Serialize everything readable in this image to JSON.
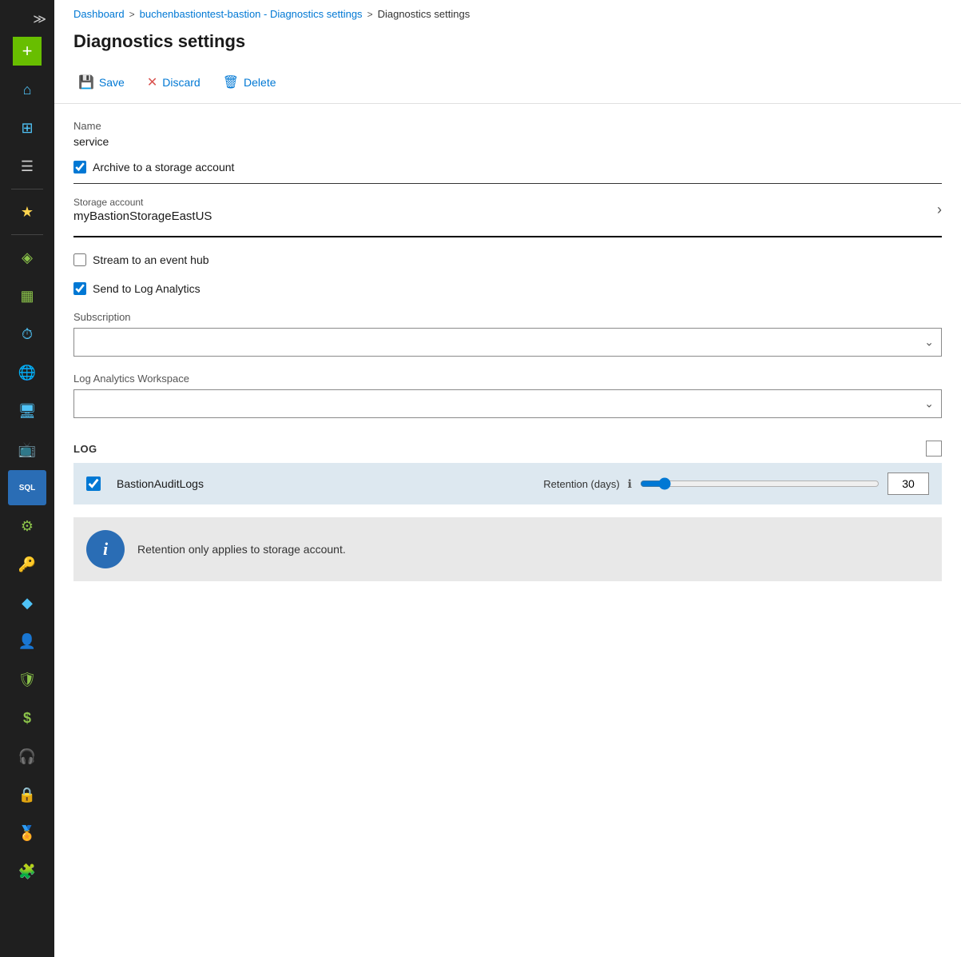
{
  "breadcrumb": {
    "items": [
      "Dashboard",
      "buchenbastiontest-bastion - Diagnostics settings",
      "Diagnostics settings"
    ],
    "separators": [
      ">",
      ">"
    ]
  },
  "page": {
    "title": "Diagnostics settings"
  },
  "toolbar": {
    "save_label": "Save",
    "discard_label": "Discard",
    "delete_label": "Delete"
  },
  "form": {
    "name_label": "Name",
    "name_value": "service",
    "archive_checkbox_label": "Archive to a storage account",
    "archive_checked": true,
    "storage_account_label": "Storage account",
    "storage_account_value": "myBastionStorageEastUS",
    "event_hub_checkbox_label": "Stream to an event hub",
    "event_hub_checked": false,
    "log_analytics_checkbox_label": "Send to Log Analytics",
    "log_analytics_checked": true,
    "subscription_label": "Subscription",
    "subscription_value": "",
    "log_analytics_workspace_label": "Log Analytics Workspace",
    "log_analytics_workspace_value": ""
  },
  "log_section": {
    "title": "LOG",
    "rows": [
      {
        "name": "BastionAuditLogs",
        "checked": true,
        "retention_label": "Retention (days)",
        "retention_value": 30,
        "slider_min": 0,
        "slider_max": 365,
        "slider_value": 30
      }
    ]
  },
  "info_box": {
    "text": "Retention only applies to storage account."
  },
  "sidebar": {
    "icons": [
      {
        "name": "collapse-icon",
        "symbol": "≫",
        "color": "#ccc"
      },
      {
        "name": "add-icon",
        "symbol": "+",
        "color": "#fff",
        "bg": "#68be00"
      },
      {
        "name": "home-icon",
        "symbol": "⌂",
        "color": "#4fc3f7"
      },
      {
        "name": "dashboard-icon",
        "symbol": "⊞",
        "color": "#4fc3f7"
      },
      {
        "name": "menu-icon",
        "symbol": "☰",
        "color": "#ccc"
      },
      {
        "name": "favorites-icon",
        "symbol": "★",
        "color": "#ffd54f"
      },
      {
        "name": "resource-icon",
        "symbol": "◈",
        "color": "#8bc34a"
      },
      {
        "name": "grid-icon",
        "symbol": "▦",
        "color": "#8bc34a"
      },
      {
        "name": "clock-icon",
        "symbol": "⏱",
        "color": "#4fc3f7"
      },
      {
        "name": "globe-icon",
        "symbol": "🌐",
        "color": "#4fc3f7"
      },
      {
        "name": "monitor-icon",
        "symbol": "🖥",
        "color": "#4fc3f7"
      },
      {
        "name": "screen-icon",
        "symbol": "📺",
        "color": "#4fc3f7"
      },
      {
        "name": "sql-icon",
        "symbol": "SQL",
        "color": "#fff",
        "bg": "#2a6db5"
      },
      {
        "name": "settings-icon",
        "symbol": "⚙",
        "color": "#8bc34a"
      },
      {
        "name": "key-icon",
        "symbol": "🔑",
        "color": "#ffd54f"
      },
      {
        "name": "devops-icon",
        "symbol": "◆",
        "color": "#4fc3f7"
      },
      {
        "name": "user-icon",
        "symbol": "👤",
        "color": "#4fc3f7"
      },
      {
        "name": "shield-icon",
        "symbol": "🛡",
        "color": "#8bc34a"
      },
      {
        "name": "dollar-icon",
        "symbol": "$",
        "color": "#8bc34a"
      },
      {
        "name": "support-icon",
        "symbol": "🎧",
        "color": "#ccc"
      },
      {
        "name": "lock-icon",
        "symbol": "🔒",
        "color": "#ccc"
      },
      {
        "name": "badge-icon",
        "symbol": "🏅",
        "color": "#ff9800"
      },
      {
        "name": "bottom-icon",
        "symbol": "🧩",
        "color": "#4fc3f7"
      }
    ]
  }
}
